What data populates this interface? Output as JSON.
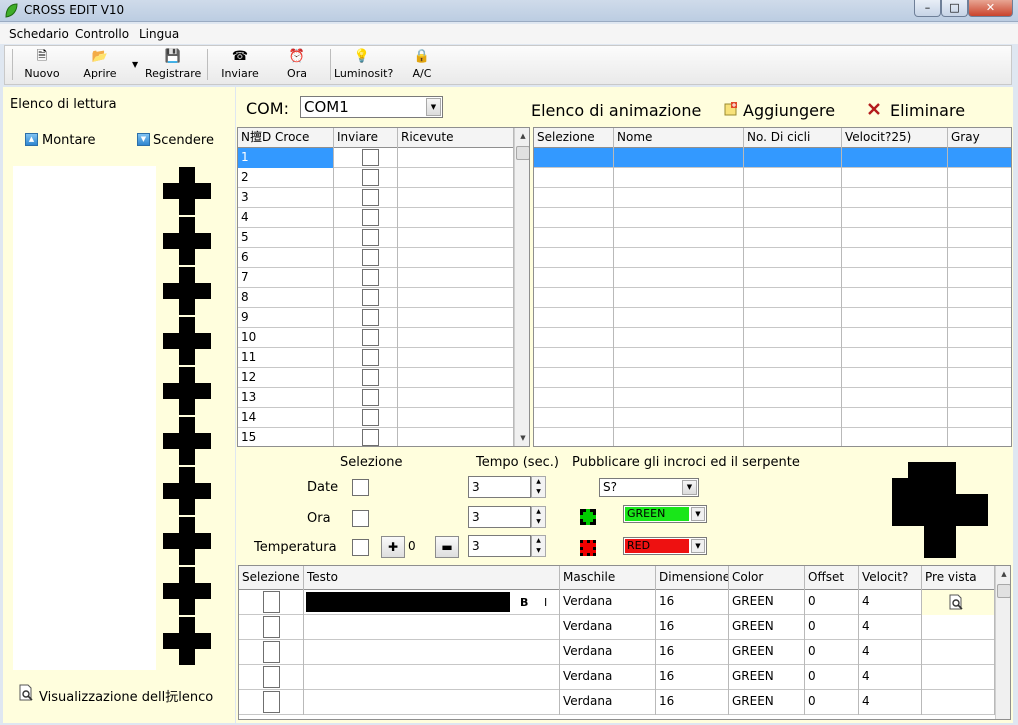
{
  "window": {
    "title": "CROSS EDIT V10",
    "minimize": "–",
    "maximize": "□",
    "close": "✕"
  },
  "menu": [
    "Schedario",
    "Controllo",
    "Lingua"
  ],
  "toolbar": [
    {
      "label": "Nuovo",
      "icon": "new-file-icon",
      "glyph": "🗎"
    },
    {
      "label": "Aprire",
      "icon": "open-folder-icon",
      "glyph": "📂"
    },
    {
      "label": "Registrare",
      "icon": "save-icon",
      "glyph": "💾"
    },
    {
      "label": "Inviare",
      "icon": "phone-icon",
      "glyph": "☎"
    },
    {
      "label": "Ora",
      "icon": "alarm-clock-icon",
      "glyph": "⏰"
    },
    {
      "label": "Luminosit?",
      "icon": "light-bulb-icon",
      "glyph": "💡"
    },
    {
      "label": "A/C",
      "icon": "lock-icon",
      "glyph": "🔒"
    }
  ],
  "left": {
    "title": "Elenco di lettura",
    "up_label": "Montare",
    "down_label": "Scendere",
    "view_list_label": "Visualizzazione dell抏lenco"
  },
  "com": {
    "label": "COM:",
    "value": "COM1"
  },
  "anim": {
    "title": "Elenco di animazione",
    "add_label": "Aggiungere",
    "delete_label": "Eliminare"
  },
  "cross_table": {
    "headers": [
      "N擅D Croce",
      "Inviare",
      "Ricevute"
    ],
    "rows": [
      "1",
      "2",
      "3",
      "4",
      "5",
      "6",
      "7",
      "8",
      "9",
      "10",
      "11",
      "12",
      "13",
      "14",
      "15"
    ]
  },
  "anim_table": {
    "headers": [
      "Selezione",
      "Nome",
      "No. Di cicli",
      "Velocit?25)",
      "Gray"
    ],
    "row_count": 15
  },
  "settings": {
    "selezione_label": "Selezione",
    "tempo_label": "Tempo (sec.)",
    "publish_label": "Pubblicare gli incroci ed il serpente",
    "date_label": "Date",
    "ora_label": "Ora",
    "temperatura_label": "Temperatura",
    "date_time": "3",
    "ora_time": "3",
    "temp_time": "3",
    "temp_offset": "0",
    "plus": "✚",
    "minus": "▬",
    "publish_value": "S?",
    "green_value": "GREEN",
    "red_value": "RED",
    "green_color": "#19e619",
    "red_color": "#ee1111"
  },
  "text_table": {
    "headers": [
      "Selezione",
      "Testo",
      "Maschile",
      "Dimensione",
      "Color",
      "Offset",
      "Velocit?",
      "Pre vista"
    ],
    "bold": "B",
    "italic": "I",
    "rows": [
      {
        "font": "Verdana",
        "size": "16",
        "color": "GREEN",
        "offset": "0",
        "speed": "4"
      },
      {
        "font": "Verdana",
        "size": "16",
        "color": "GREEN",
        "offset": "0",
        "speed": "4"
      },
      {
        "font": "Verdana",
        "size": "16",
        "color": "GREEN",
        "offset": "0",
        "speed": "4"
      },
      {
        "font": "Verdana",
        "size": "16",
        "color": "GREEN",
        "offset": "0",
        "speed": "4"
      },
      {
        "font": "Verdana",
        "size": "16",
        "color": "GREEN",
        "offset": "0",
        "speed": "4"
      }
    ]
  }
}
